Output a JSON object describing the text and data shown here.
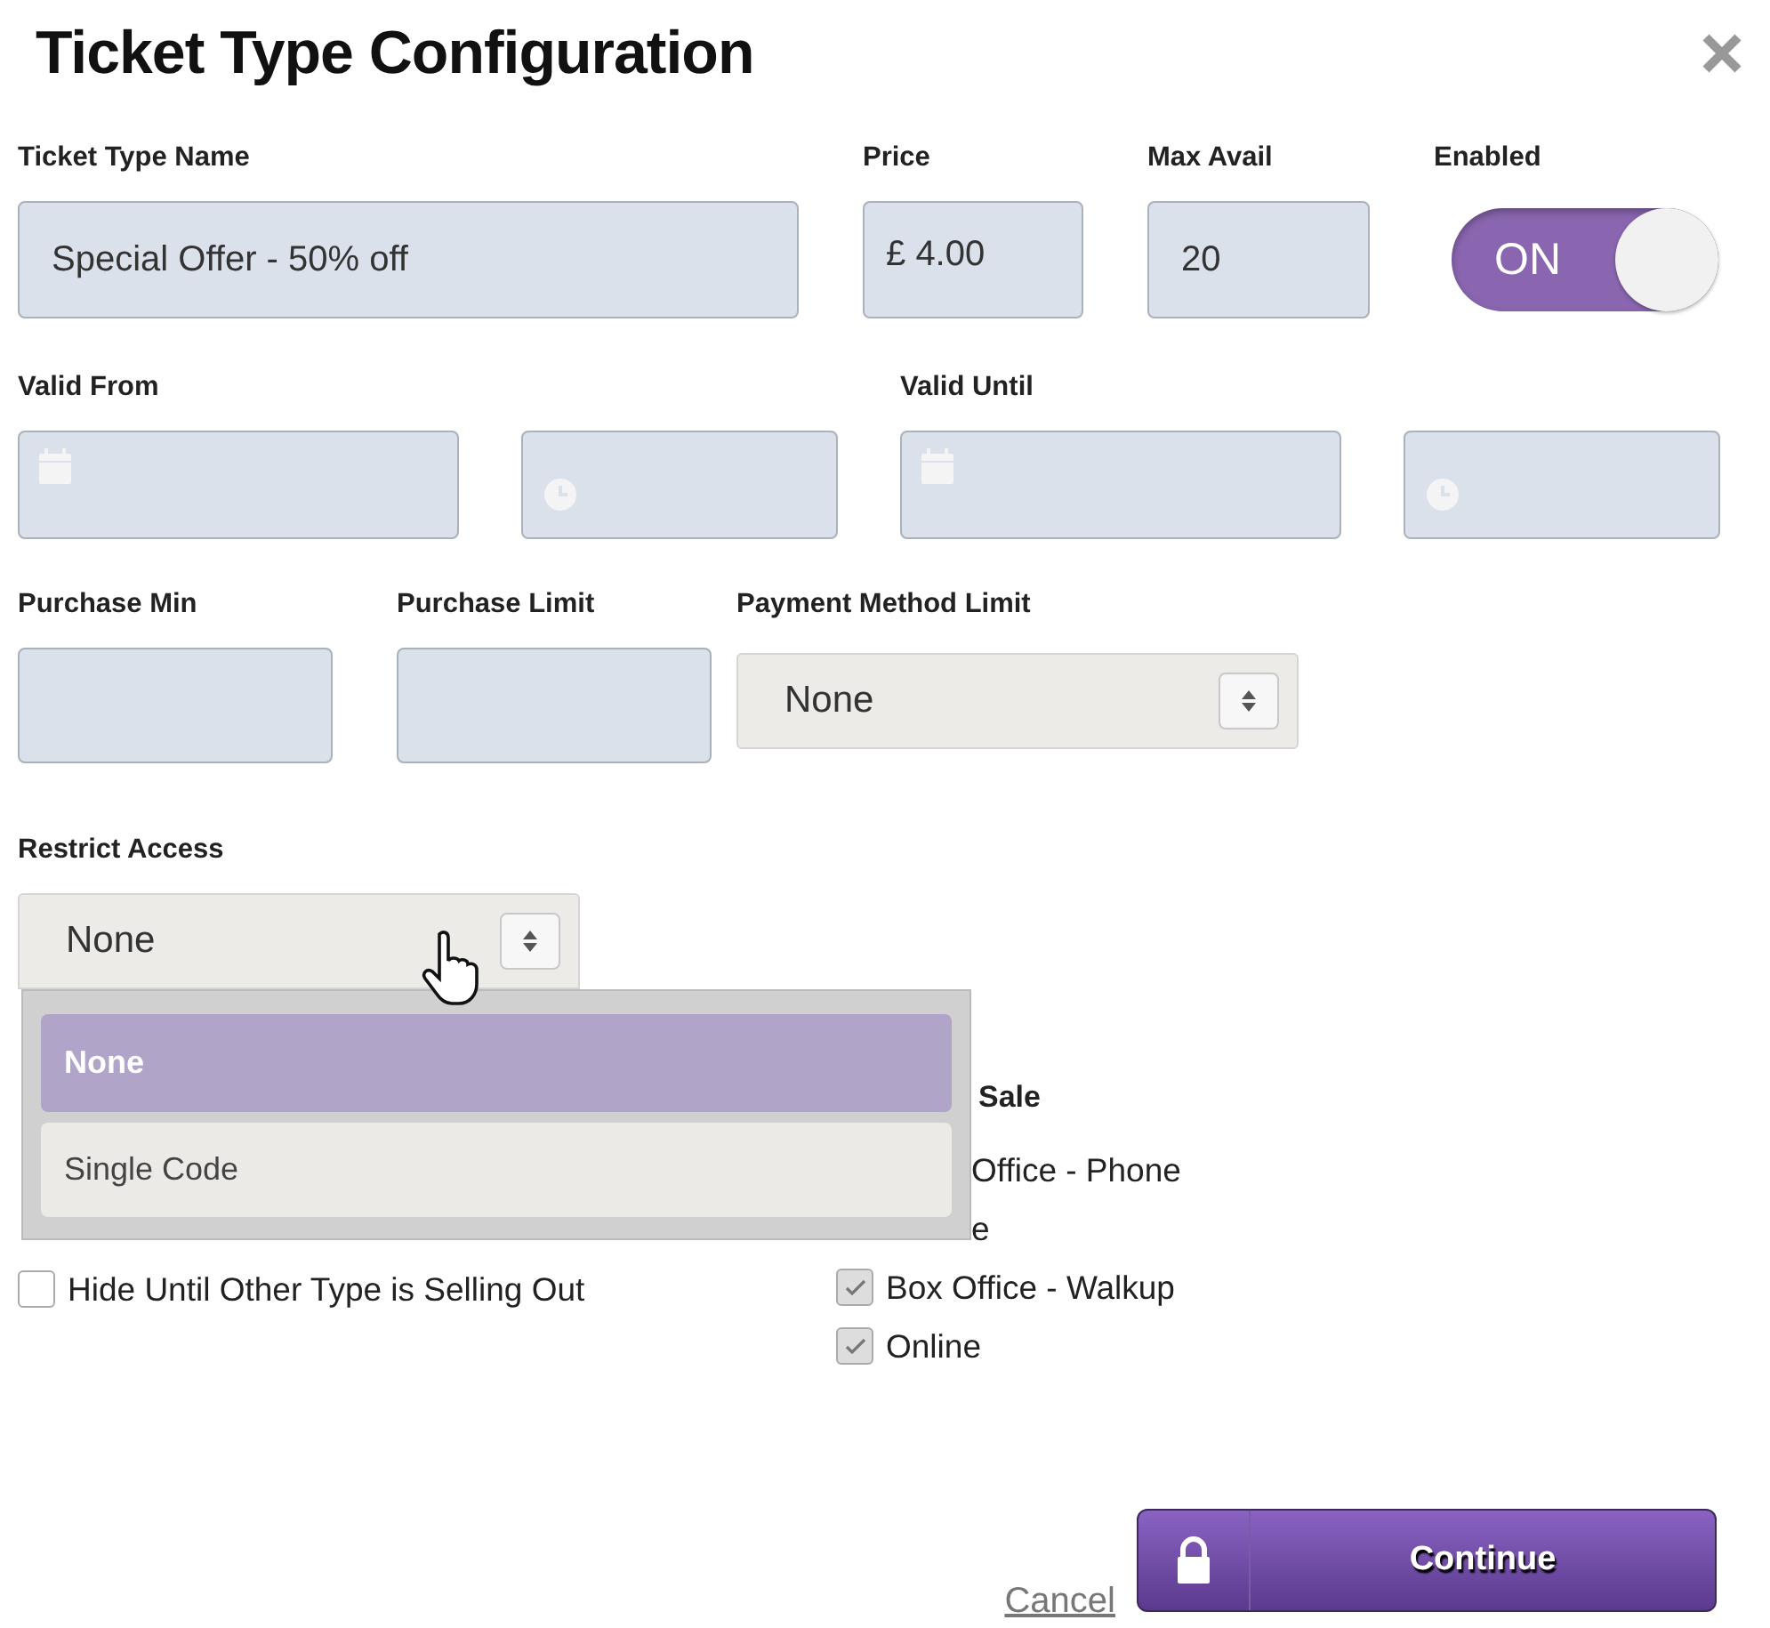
{
  "title": "Ticket Type Configuration",
  "ticket_type_name": {
    "label": "Ticket Type Name",
    "value": "Special Offer - 50% off"
  },
  "price": {
    "label": "Price",
    "currency": "£",
    "value": "4.00"
  },
  "max_avail": {
    "label": "Max Avail",
    "value": "20"
  },
  "enabled": {
    "label": "Enabled",
    "on": true,
    "text": "ON"
  },
  "valid_from": {
    "label": "Valid From"
  },
  "valid_until": {
    "label": "Valid Until"
  },
  "purchase_min": {
    "label": "Purchase Min"
  },
  "purchase_limit": {
    "label": "Purchase Limit"
  },
  "payment_method_limit": {
    "label": "Payment Method Limit",
    "value": "None"
  },
  "restrict_access": {
    "label": "Restrict Access",
    "value": "None",
    "expanded": true,
    "options": [
      {
        "label": "None",
        "selected": true
      },
      {
        "label": "Single Code",
        "selected": false
      }
    ]
  },
  "left_options": [
    {
      "kind": "checkbox",
      "label": "Hide Until Other Type is Selling Out",
      "checked": false
    }
  ],
  "sale_heading": "Sale",
  "sale_options": [
    {
      "kind": "partial",
      "label": "Office - Phone"
    },
    {
      "kind": "partial",
      "label": "e"
    },
    {
      "kind": "checkbox",
      "label": "Box Office - Walkup",
      "checked": true
    },
    {
      "kind": "checkbox",
      "label": "Online",
      "checked": true
    }
  ],
  "cancel": "Cancel",
  "continue": "Continue"
}
